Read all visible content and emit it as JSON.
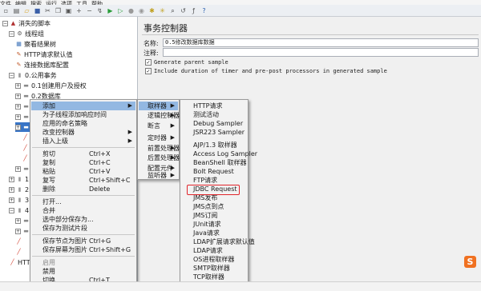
{
  "menubar": [
    "文件",
    "编辑",
    "搜索",
    "运行",
    "选项",
    "工具",
    "帮助"
  ],
  "toolbar_icons": [
    "new-icon",
    "templates-icon",
    "open-icon",
    "save-icon",
    "cut-icon",
    "copy-icon",
    "paste-icon",
    "expand-icon",
    "collapse-icon",
    "toggle-icon",
    "start-icon",
    "start-no-pause-icon",
    "stop-icon",
    "shutdown-icon",
    "clear-icon",
    "clear-all-icon",
    "search-icon",
    "reset-search-icon",
    "function-helper-icon",
    "help-icon"
  ],
  "tree": {
    "items": [
      {
        "label": "消失的脚本",
        "indent": 0,
        "exp": "−",
        "icon": "test-plan-icon"
      },
      {
        "label": "线程组",
        "indent": 1,
        "exp": "−",
        "icon": "gear-icon"
      },
      {
        "label": "察看结果树",
        "indent": 2,
        "exp": "",
        "icon": "listener-icon"
      },
      {
        "label": "HTTP请求默认值",
        "indent": 2,
        "exp": "",
        "icon": "wrench-icon"
      },
      {
        "label": "连接数据库配置",
        "indent": 2,
        "exp": "",
        "icon": "wrench-icon"
      },
      {
        "label": "0.公用事务",
        "indent": 1,
        "exp": "−",
        "icon": "folder-icon"
      },
      {
        "label": "0.1创建用户及授权",
        "indent": 2,
        "exp": "+",
        "icon": "controller-icon"
      },
      {
        "label": "0.2数据库",
        "indent": 2,
        "exp": "+",
        "icon": "controller-icon"
      },
      {
        "label": "0.3获取图形验证码【需要打开工具】",
        "indent": 2,
        "exp": "+",
        "icon": "controller-icon"
      },
      {
        "label": "0.4redis获取验证码",
        "indent": 2,
        "exp": "+",
        "icon": "controller-icon"
      },
      {
        "label": "",
        "indent": 2,
        "exp": "+",
        "icon": "controller-icon",
        "selected": true
      },
      {
        "label": "",
        "indent": 3,
        "exp": "",
        "icon": "sampler-icon"
      },
      {
        "label": "",
        "indent": 3,
        "exp": "",
        "icon": "sampler-icon"
      },
      {
        "label": "",
        "indent": 3,
        "exp": "",
        "icon": "sampler-icon"
      },
      {
        "label": "",
        "indent": 2,
        "exp": "+",
        "icon": "controller-icon"
      },
      {
        "label": "1.",
        "indent": 1,
        "exp": "+",
        "icon": "folder-icon"
      },
      {
        "label": "2",
        "indent": 1,
        "exp": "+",
        "icon": "folder-icon"
      },
      {
        "label": "3",
        "indent": 1,
        "exp": "+",
        "icon": "folder-icon"
      },
      {
        "label": "4",
        "indent": 1,
        "exp": "−",
        "icon": "folder-icon"
      },
      {
        "label": "",
        "indent": 2,
        "exp": "+",
        "icon": "controller-icon"
      },
      {
        "label": "",
        "indent": 2,
        "exp": "+",
        "icon": "controller-icon"
      },
      {
        "label": "",
        "indent": 2,
        "exp": "",
        "icon": "sampler-icon"
      },
      {
        "label": "",
        "indent": 2,
        "exp": "",
        "icon": "sampler-icon"
      },
      {
        "label": "HTTP",
        "indent": 1,
        "exp": "",
        "icon": "sampler-icon"
      }
    ]
  },
  "panel": {
    "title": "事务控制器",
    "name_label": "名称:",
    "name_value": "0.5修改数据库数据",
    "comment_label": "注释:",
    "comment_value": "",
    "cb_parent": "Generate parent sample",
    "cb_duration": "Include duration of timer and pre-post processors in generated sample",
    "cb_parent_checked": true,
    "cb_duration_checked": true
  },
  "context_menu": {
    "items": [
      {
        "label": "添加",
        "key": "",
        "arrow": true,
        "hl": true
      },
      {
        "label": "为子线程添加响应时间",
        "key": ""
      },
      {
        "label": "应用的命名策略",
        "key": ""
      },
      {
        "label": "改变控制器",
        "key": "",
        "arrow": true
      },
      {
        "label": "插入上级",
        "key": "",
        "arrow": true
      },
      {
        "sep": true
      },
      {
        "label": "剪切",
        "key": "Ctrl+X"
      },
      {
        "label": "复制",
        "key": "Ctrl+C"
      },
      {
        "label": "粘贴",
        "key": "Ctrl+V"
      },
      {
        "label": "复写",
        "key": "Ctrl+Shift+C"
      },
      {
        "label": "删除",
        "key": "Delete"
      },
      {
        "sep": true
      },
      {
        "label": "打开...",
        "key": ""
      },
      {
        "label": "合并",
        "key": ""
      },
      {
        "label": "选中部分保存为...",
        "key": ""
      },
      {
        "label": "保存为测试片段",
        "key": ""
      },
      {
        "sep": true
      },
      {
        "label": "保存节点为图片",
        "key": "Ctrl+G"
      },
      {
        "label": "保存屏幕为图片",
        "key": "Ctrl+Shift+G"
      },
      {
        "sep": true
      },
      {
        "label": "启用",
        "key": "",
        "dis": true
      },
      {
        "label": "禁用",
        "key": ""
      },
      {
        "label": "切换",
        "key": "Ctrl+T"
      }
    ]
  },
  "add_menu": {
    "items": [
      {
        "label": "取样器",
        "hl": true
      },
      {
        "label": "逻辑控制器"
      },
      {
        "label": "断言"
      },
      {
        "label": "定时器"
      },
      {
        "label": "前置处理器"
      },
      {
        "label": "后置处理器"
      },
      {
        "label": "配置元件"
      },
      {
        "label": "监听器"
      }
    ]
  },
  "sampler_menu": {
    "items": [
      "HTTP请求",
      "测试活动",
      "Debug Sampler",
      "JSR223 Sampler",
      "AJP/1.3 取样器",
      "Access Log Sampler",
      "BeanShell 取样器",
      "Bolt Request",
      "FTP请求",
      "JDBC Request",
      "JMS发布",
      "JMS点到点",
      "JMS订阅",
      "JUnit请求",
      "Java请求",
      "LDAP扩展请求默认值",
      "LDAP请求",
      "OS进程取样器",
      "SMTP取样器",
      "TCP取样器",
      "邮件阅读者取样器"
    ],
    "highlighted": "JDBC Request"
  },
  "colors": {
    "selection": "#3975c6",
    "menu_highlight": "#93b8e2",
    "red_box": "#e0242a",
    "logo": "#f07121"
  },
  "logo_text": "S"
}
